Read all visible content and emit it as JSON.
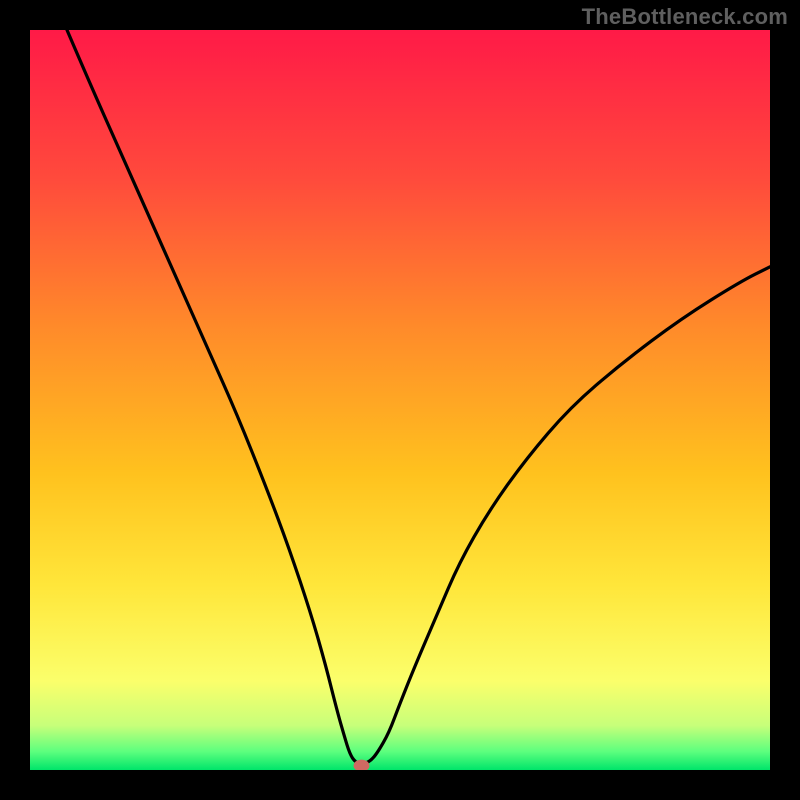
{
  "watermark": "TheBottleneck.com",
  "colors": {
    "frame": "#000000",
    "gradient_stops": [
      {
        "offset": 0.0,
        "color": "#ff1a47"
      },
      {
        "offset": 0.2,
        "color": "#ff4a3c"
      },
      {
        "offset": 0.4,
        "color": "#ff8a2a"
      },
      {
        "offset": 0.6,
        "color": "#ffc21e"
      },
      {
        "offset": 0.75,
        "color": "#ffe63a"
      },
      {
        "offset": 0.88,
        "color": "#fbff6b"
      },
      {
        "offset": 0.94,
        "color": "#c7ff7a"
      },
      {
        "offset": 0.975,
        "color": "#5dff7e"
      },
      {
        "offset": 1.0,
        "color": "#00e56a"
      }
    ],
    "curve": "#000000",
    "marker": "#cf6a62"
  },
  "chart_data": {
    "type": "line",
    "title": "",
    "xlabel": "",
    "ylabel": "",
    "xlim": [
      0,
      100
    ],
    "ylim": [
      0,
      100
    ],
    "series": [
      {
        "name": "bottleneck-curve",
        "x": [
          5,
          8,
          12,
          16,
          20,
          24,
          28,
          32,
          35,
          38,
          40,
          41.5,
          42.5,
          43.2,
          44,
          45,
          46,
          47,
          48.5,
          50,
          52,
          55,
          58,
          62,
          67,
          73,
          80,
          88,
          96,
          100
        ],
        "y": [
          100,
          93,
          84,
          75,
          66,
          57,
          48,
          38,
          30,
          21,
          14,
          8,
          4.5,
          2.2,
          1,
          0.8,
          1.2,
          2.4,
          5,
          9,
          14,
          21,
          28,
          35,
          42,
          49,
          55,
          61,
          66,
          68
        ]
      }
    ],
    "annotations": [
      {
        "name": "optimum-marker",
        "x": 44.8,
        "y": 0.6
      }
    ]
  }
}
